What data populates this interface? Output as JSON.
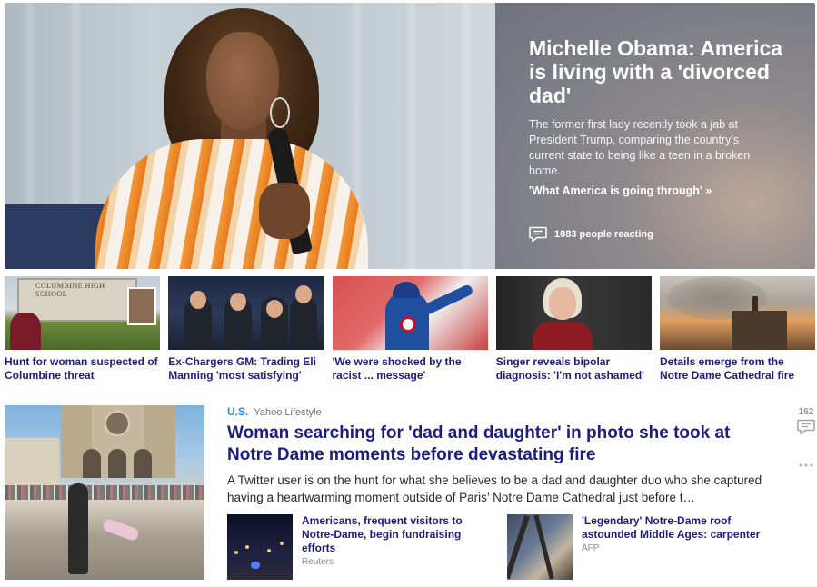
{
  "hero": {
    "title": "Michelle Obama: America is living with a 'divorced dad'",
    "summary": "The former first lady recently took a jab at President Trump, comparing the country’s current state to being like a teen in a broken home.",
    "link_label": "'What America is going through' »",
    "reactions_label": "1083 people reacting",
    "icons": {
      "reactions": "comment-bubble-icon"
    }
  },
  "strip": {
    "items": [
      {
        "caption": "Hunt for woman suspected of Columbine threat",
        "thumb_text": "COLUMBINE HIGH SCHOOL"
      },
      {
        "caption": "Ex-Chargers GM: Trading Eli Manning 'most satisfying'"
      },
      {
        "caption": "'We were shocked by the racist ... message'"
      },
      {
        "caption": "Singer reveals bipolar diagnosis: 'I'm not ashamed'"
      },
      {
        "caption": "Details emerge from the Notre Dame Cathedral fire"
      }
    ]
  },
  "featured": {
    "category": "U.S.",
    "source": "Yahoo Lifestyle",
    "title": "Woman searching for 'dad and daughter' in photo she took at Notre Dame moments before devastating fire",
    "summary": "A Twitter user is on the hunt for what she believes to be a dad and daughter duo who she captured having a heartwarming moment outside of Paris’ Notre Dame Cathedral just before t…",
    "comment_count": "162",
    "icons": {
      "comments": "comment-bubble-icon",
      "more": "more-dots-icon"
    },
    "related": [
      {
        "title": "Americans, frequent visitors to Notre-Dame, begin fundraising efforts",
        "source": "Reuters"
      },
      {
        "title": "'Legendary' Notre-Dame roof astounded Middle Ages: carpenter",
        "source": "AFP"
      }
    ]
  },
  "colors": {
    "headline": "#1d1d7e",
    "category": "#188fff",
    "meta": "#6e7780"
  }
}
